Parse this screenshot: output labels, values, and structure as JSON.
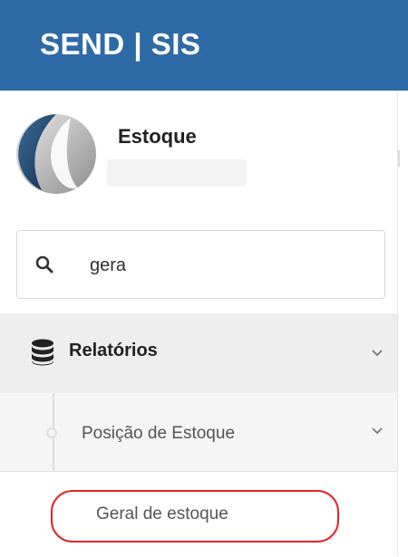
{
  "header": {
    "brand": "SEND | SIS",
    "background": "#2d6aa6"
  },
  "profile": {
    "name": "Estoque",
    "logo_icon": "company-logo-icon"
  },
  "search": {
    "value": "gera",
    "icon": "search-icon"
  },
  "menu": {
    "section": {
      "label": "Relatórios",
      "icon": "database-icon",
      "expanded": true
    },
    "subsection": {
      "label": "Posição de Estoque",
      "expanded": true
    },
    "item": {
      "label": "Geral de estoque",
      "highlight_color": "#e3242b"
    }
  }
}
